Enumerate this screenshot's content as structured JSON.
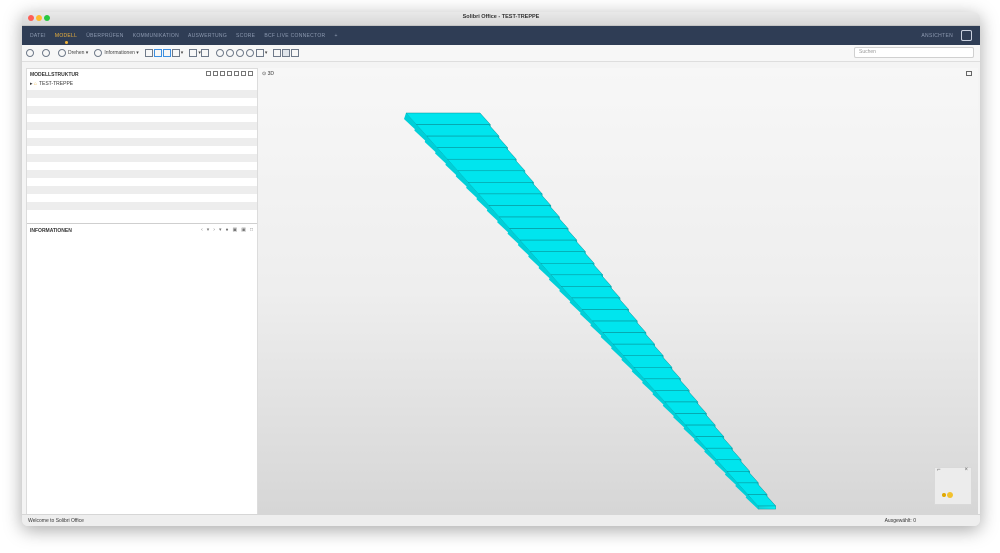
{
  "window": {
    "title": "Solibri Office - TEST-TREPPE"
  },
  "menu": {
    "items": [
      "DATEI",
      "MODELL",
      "ÜBERPRÜFEN",
      "KOMMUNIKATION",
      "AUSWERTUNG",
      "SCORE",
      "BCF LIVE CONNECTOR",
      "+"
    ],
    "active": "MODELL",
    "views_label": "ANSICHTEN"
  },
  "toolbar": {
    "rotate_label": "Drehen",
    "info_label": "Informationen",
    "search_placeholder": "Suchen"
  },
  "left_panel": {
    "structure_title": "MODELLSTRUKTUR",
    "root_item": "TEST-TREPPE",
    "info_title": "INFORMATIONEN"
  },
  "view": {
    "tab_label": "3D",
    "stair_color": "#00e5ee",
    "accent": "#f0b43c"
  },
  "status": {
    "left": "Welcome to Solibri Office",
    "right": "Ausgewählt: 0"
  },
  "icons": [
    "undo-icon",
    "redo-icon",
    "rotate-icon",
    "info-icon",
    "zoom-in-icon",
    "zoom-out-icon",
    "search-icon",
    "views-icon",
    "maximize-icon",
    "close-icon"
  ]
}
